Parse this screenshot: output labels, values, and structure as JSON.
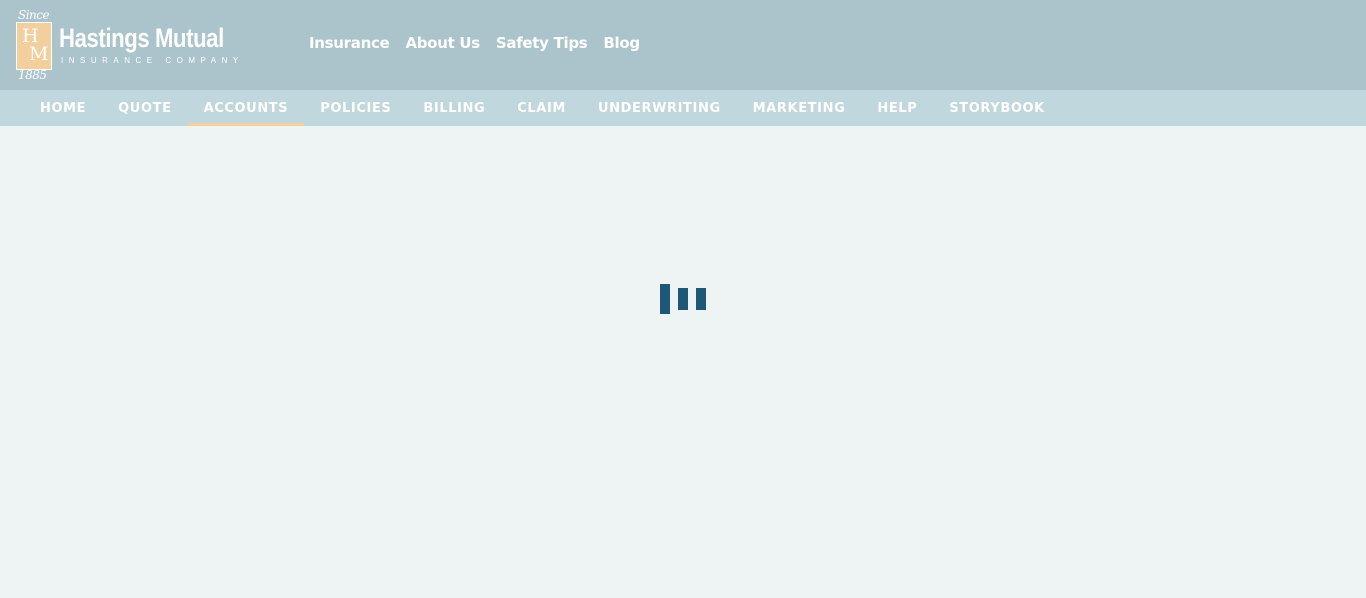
{
  "logo": {
    "since": "Since",
    "letter_h": "H",
    "letter_m": "M",
    "year": "1885",
    "name": "Hastings Mutual",
    "tagline": "INSURANCE COMPANY",
    "colors": {
      "box": "#f2cf9c",
      "text": "#ffffff"
    }
  },
  "top_nav": {
    "items": [
      {
        "label": "Insurance"
      },
      {
        "label": "About Us"
      },
      {
        "label": "Safety Tips"
      },
      {
        "label": "Blog"
      }
    ]
  },
  "main_nav": {
    "active": "ACCOUNTS",
    "items": [
      {
        "label": "HOME"
      },
      {
        "label": "QUOTE"
      },
      {
        "label": "ACCOUNTS"
      },
      {
        "label": "POLICIES"
      },
      {
        "label": "BILLING"
      },
      {
        "label": "CLAIM"
      },
      {
        "label": "UNDERWRITING"
      },
      {
        "label": "MARKETING"
      },
      {
        "label": "HELP"
      },
      {
        "label": "STORYBOOK"
      }
    ]
  },
  "loader": {
    "icon": "loading-bars-icon",
    "color": "#1f5877"
  },
  "colors": {
    "header_bg": "#abc3cb",
    "subnav_bg": "#c0d7de",
    "page_bg": "#eef3f4",
    "active_underline": "#f2cf9c"
  }
}
